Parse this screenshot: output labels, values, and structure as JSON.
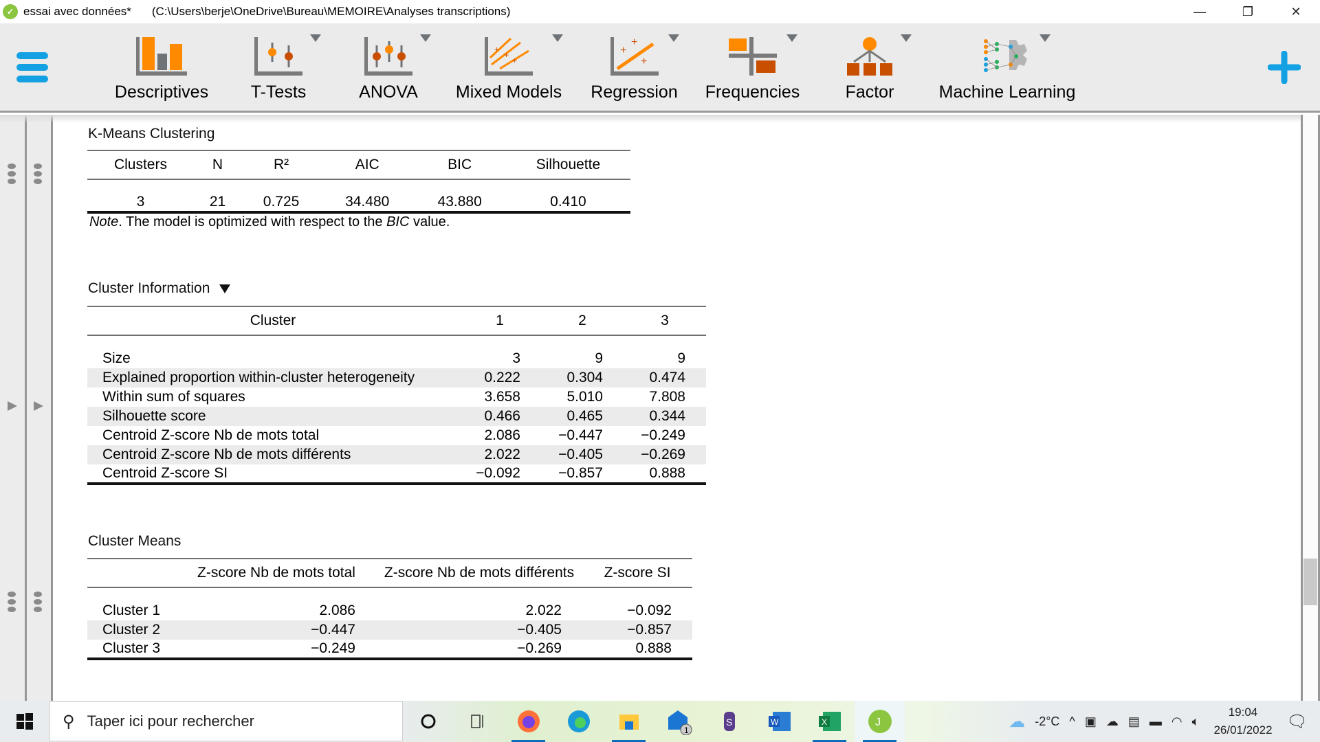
{
  "window": {
    "app_name": "essai avec données*",
    "path": "(C:\\Users\\berje\\OneDrive\\Bureau\\MEMOIRE\\Analyses transcriptions)",
    "minimize_icon": "—",
    "restore_icon": "❐",
    "close_icon": "✕"
  },
  "ribbon": {
    "items": [
      {
        "label": "Descriptives",
        "icon": "bar-chart-icon",
        "has_dropdown": false
      },
      {
        "label": "T-Tests",
        "icon": "ttest-icon",
        "has_dropdown": true
      },
      {
        "label": "ANOVA",
        "icon": "anova-icon",
        "has_dropdown": true
      },
      {
        "label": "Mixed Models",
        "icon": "mixed-models-icon",
        "has_dropdown": true
      },
      {
        "label": "Regression",
        "icon": "regression-icon",
        "has_dropdown": true
      },
      {
        "label": "Frequencies",
        "icon": "frequencies-icon",
        "has_dropdown": true
      },
      {
        "label": "Factor",
        "icon": "factor-icon",
        "has_dropdown": true
      },
      {
        "label": "Machine Learning",
        "icon": "machine-learning-icon",
        "has_dropdown": true
      }
    ],
    "colors": {
      "accent_blue": "#14a1e3",
      "orange": "#ff8a00",
      "dark_orange": "#c94f00",
      "gray": "#7a7a7a"
    }
  },
  "kmeans": {
    "title": "K-Means Clustering",
    "columns": [
      "Clusters",
      "N",
      "R²",
      "AIC",
      "BIC",
      "Silhouette"
    ],
    "row": [
      "3",
      "21",
      "0.725",
      "34.480",
      "43.880",
      "0.410"
    ],
    "note_prefix": "Note",
    "note_mid": ". The model is optimized with respect to the ",
    "note_em": "BIC",
    "note_suffix": " value."
  },
  "cluster_info": {
    "title": "Cluster Information",
    "columns": [
      "Cluster",
      "1",
      "2",
      "3"
    ],
    "rows": [
      {
        "label": "Size",
        "values": [
          "3",
          "9",
          "9"
        ]
      },
      {
        "label": "Explained proportion within-cluster heterogeneity",
        "values": [
          "0.222",
          "0.304",
          "0.474"
        ]
      },
      {
        "label": "Within sum of squares",
        "values": [
          "3.658",
          "5.010",
          "7.808"
        ]
      },
      {
        "label": "Silhouette score",
        "values": [
          "0.466",
          "0.465",
          "0.344"
        ]
      },
      {
        "label": "Centroid Z-score Nb de mots total",
        "values": [
          "2.086",
          "−0.447",
          "−0.249"
        ]
      },
      {
        "label": "Centroid Z-score Nb de mots différents",
        "values": [
          "2.022",
          "−0.405",
          "−0.269"
        ]
      },
      {
        "label": "Centroid Z-score SI",
        "values": [
          "−0.092",
          "−0.857",
          "0.888"
        ]
      }
    ]
  },
  "cluster_means": {
    "title": "Cluster Means",
    "columns": [
      "",
      "Z-score Nb de mots total",
      "Z-score Nb de mots différents",
      "Z-score SI"
    ],
    "rows": [
      {
        "label": "Cluster 1",
        "values": [
          "2.086",
          "2.022",
          "−0.092"
        ]
      },
      {
        "label": "Cluster 2",
        "values": [
          "−0.447",
          "−0.405",
          "−0.857"
        ]
      },
      {
        "label": "Cluster 3",
        "values": [
          "−0.249",
          "−0.269",
          "0.888"
        ]
      }
    ]
  },
  "taskbar": {
    "search_placeholder": "Taper ici pour rechercher",
    "apps": [
      "cortana",
      "task-view",
      "firefox",
      "edge",
      "file-explorer",
      "mail",
      "winrar",
      "word",
      "excel",
      "jasp"
    ],
    "mail_badge": "1",
    "weather": "-2°C",
    "time": "19:04",
    "date": "26/01/2022"
  }
}
